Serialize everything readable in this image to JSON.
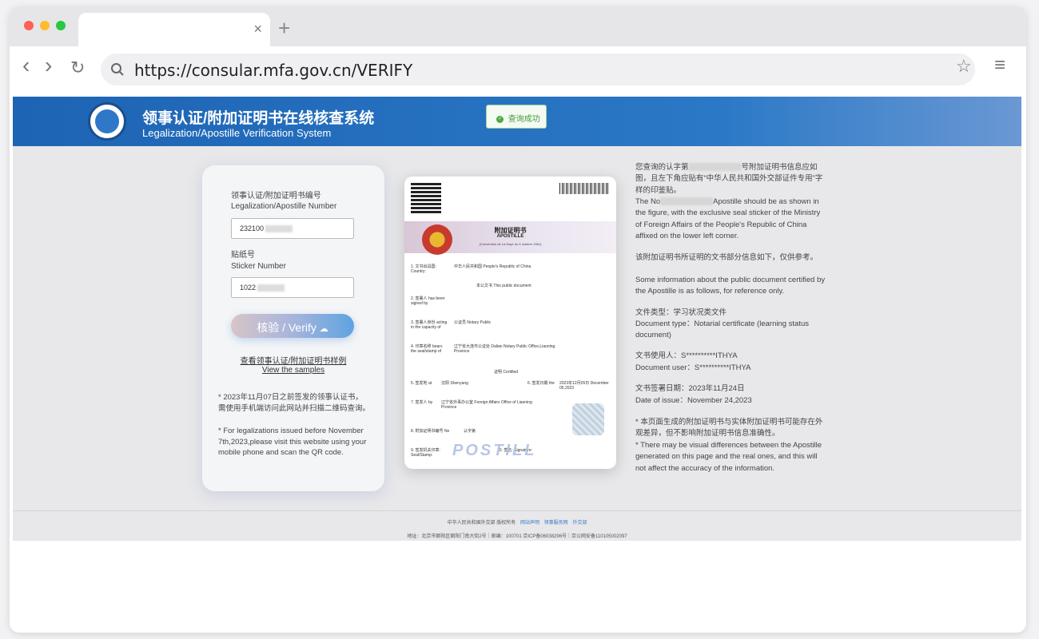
{
  "browser": {
    "url": "https://consular.mfa.gov.cn/VERIFY",
    "tab_close": "×",
    "new_tab": "+",
    "back_icon": "‹",
    "forward_icon": "›",
    "reload_icon": "↻",
    "star_icon": "☆",
    "menu_icon": "≡"
  },
  "header": {
    "title_cn": "领事认证/附加证明书在线核查系统",
    "title_en": "Legalization/Apostille Verification System",
    "badge": "查询成功"
  },
  "form": {
    "number_label_cn": "领事认证/附加证明书编号",
    "number_label_en": "Legalization/Apostille Number",
    "number_value": "232100",
    "sticker_label_cn": "贴纸号",
    "sticker_label_en": "Sticker Number",
    "sticker_value": "1022",
    "verify_label": "核验 / Verify",
    "samples_cn": "查看领事认证/附加证明书样例",
    "samples_en": "View the samples",
    "note_cn": "* 2023年11月07日之前签发的领事认证书，需使用手机端访问此网站并扫描二维码查询。",
    "note_en": "* For legalizations issued before November 7th,2023,please visit this website using your mobile phone and scan the QR code."
  },
  "document": {
    "title_cn": "附加证明书",
    "title_en": "APOSTILLE",
    "convention": "(Convention de La Haye du 5 octobre 1961)",
    "rows": [
      {
        "n": "1. 文书出具国: Country:",
        "v": "中华人民共和国 People's Republic of China"
      },
      {
        "n": "",
        "v": "本公文书 This public document"
      },
      {
        "n": "2. 签署人 has been signed by",
        "v": ""
      },
      {
        "n": "3. 签署人身份 acting in the capacity of",
        "v": "公证员 Notary Public"
      },
      {
        "n": "4. 印章名称 bears the seal/stamp of",
        "v": "辽宁省大连市公证处 Dalian Notary Public Office,Liaoning Province"
      },
      {
        "n": "",
        "v": "证明 Certified"
      },
      {
        "n": "5. 签发地 at",
        "v": "沈阳 Shenyang"
      },
      {
        "n": "6. 签发日期 the",
        "v": "2023年12月05日 December 05,2023"
      },
      {
        "n": "7. 签发人 by",
        "v": "辽宁省外事办公室 Foreign Affairs Office of Liaoning Province"
      },
      {
        "n": "8. 附加证明书编号 No",
        "v": "认字第"
      },
      {
        "n": "9. 签发机关印章: Seal/Stamp:",
        "v": "10. 签名: Signature:"
      }
    ],
    "watermark": "POSTILL"
  },
  "info": {
    "p1_cn_a": "您查询的认字第",
    "p1_cn_b": "号附加证明书信息应如图，且左下角应贴有“中华人民共和国外交部证件专用”字样的印鉴贴。",
    "p1_en_a": "The No",
    "p1_en_b": "Apostille should be as shown in the figure, with the exclusive seal sticker of the Ministry of Foreign Affairs of the People's Republic of China affixed on the lower left corner.",
    "p2_cn": "该附加证明书所证明的文书部分信息如下，仅供参考。",
    "p2_en": "Some information about the public document certified by the Apostille is as follows, for reference only.",
    "doctype_cn": "文件类型：学习状况类文件",
    "doctype_en": "Document type：Notarial certificate (learning status document)",
    "user_cn": "文书使用人：S**********ITHYA",
    "user_en": "Document user：S**********ITHYA",
    "date_cn": "文书签署日期：2023年11月24日",
    "date_en": "Date of issue：November 24,2023",
    "notice_cn": "* 本页面生成的附加证明书与实体附加证明书可能存在外观差异，但不影响附加证明书信息准确性。",
    "notice_en": "* There may be visual differences between the Apostille generated on this page and the real ones, and this will not affect the accuracy of the information."
  },
  "footer": {
    "copyright": "中华人民共和国外交部 版权所有",
    "link1": "网站声明",
    "link2": "领事服务网",
    "link3": "外交部",
    "address": "地址：北京市朝阳区朝阳门南大街2号｜邮编：100701 京ICP备06038296号｜京公网安备110105002097"
  }
}
